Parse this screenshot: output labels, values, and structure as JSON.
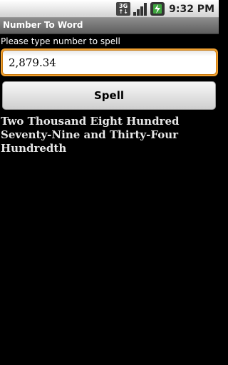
{
  "status_bar": {
    "network_label_top": "3G",
    "network_label_bottom": "↑↓",
    "signal_icon": "signal-bars-icon",
    "battery_icon": "battery-charging-icon",
    "time": "9:32 PM"
  },
  "app": {
    "title": "Number To Word"
  },
  "form": {
    "prompt": "Please type number to spell",
    "input_value": "2,879.34",
    "spell_label": "Spell"
  },
  "result": {
    "text": "Two Thousand Eight Hundred Seventy-Nine and Thirty-Four Hundredth"
  },
  "colors": {
    "background": "#000000",
    "input_focus": "#f0a030",
    "title_bar": "#6e6e6e"
  }
}
